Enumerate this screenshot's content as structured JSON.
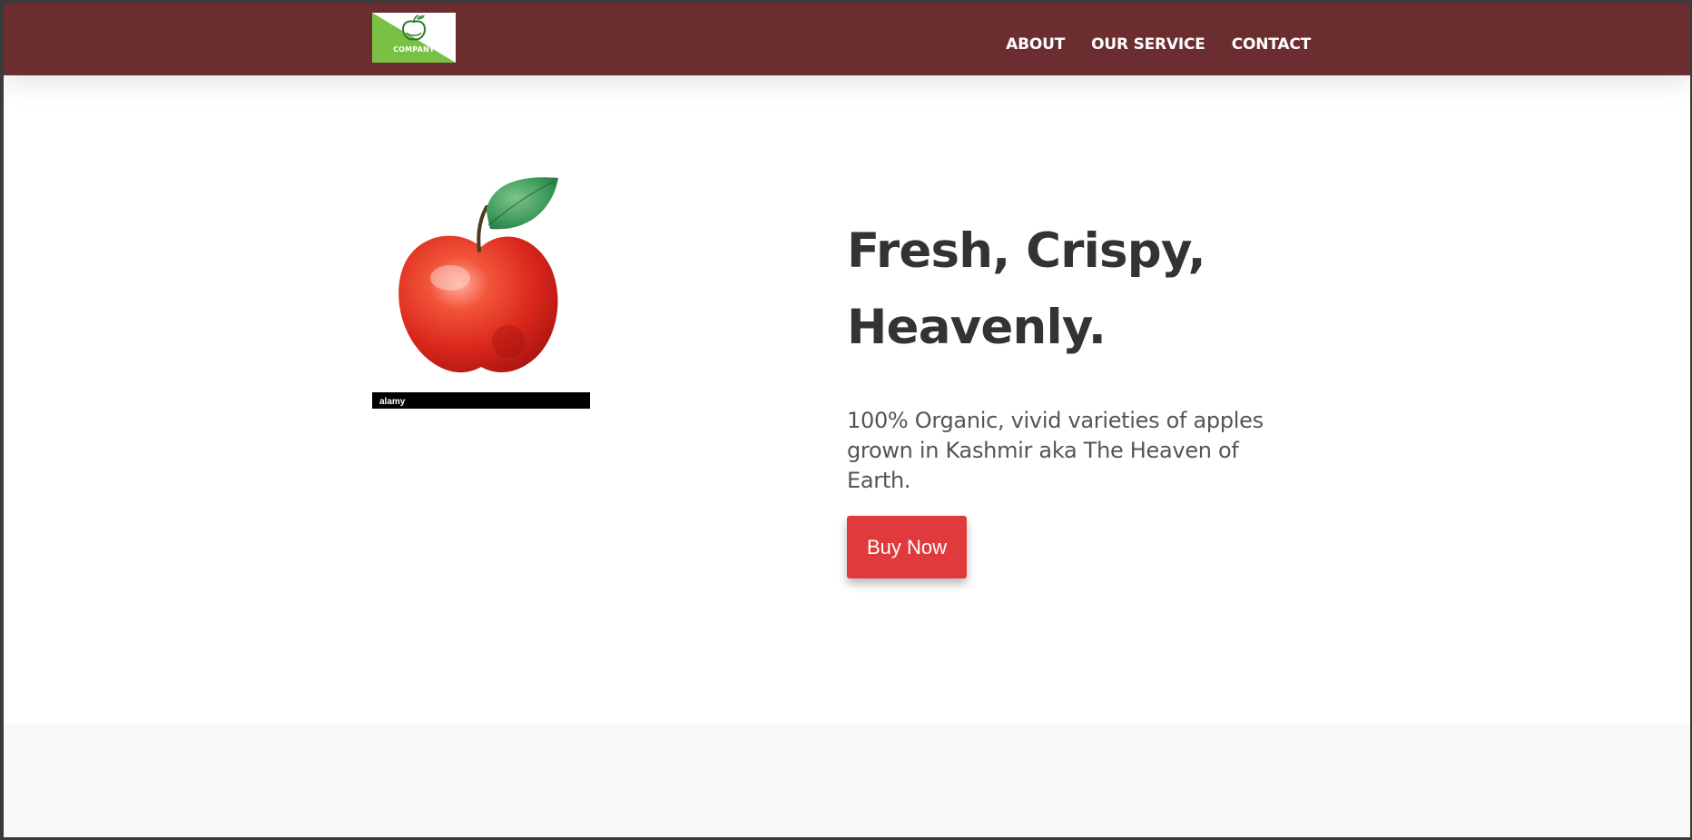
{
  "header": {
    "logo_text": "COMPANY",
    "logo_colors": {
      "green": "#7ac143",
      "white": "#ffffff"
    },
    "background_color": "#6b2d2f",
    "nav": [
      {
        "label": "ABOUT"
      },
      {
        "label": "OUR SERVICE"
      },
      {
        "label": "CONTACT"
      }
    ]
  },
  "hero": {
    "image": {
      "subject": "watercolor red apple with green leaf",
      "watermark_text": "alamy"
    },
    "headline": "Fresh, Crispy, Heavenly.",
    "tagline": "100% Organic, vivid varieties of apples grown in Kashmir aka The Heaven of Earth.",
    "buy_button": {
      "label": "Buy Now",
      "color": "#e03a3c"
    }
  },
  "footer": {
    "background_color": "#f8f8f8"
  }
}
